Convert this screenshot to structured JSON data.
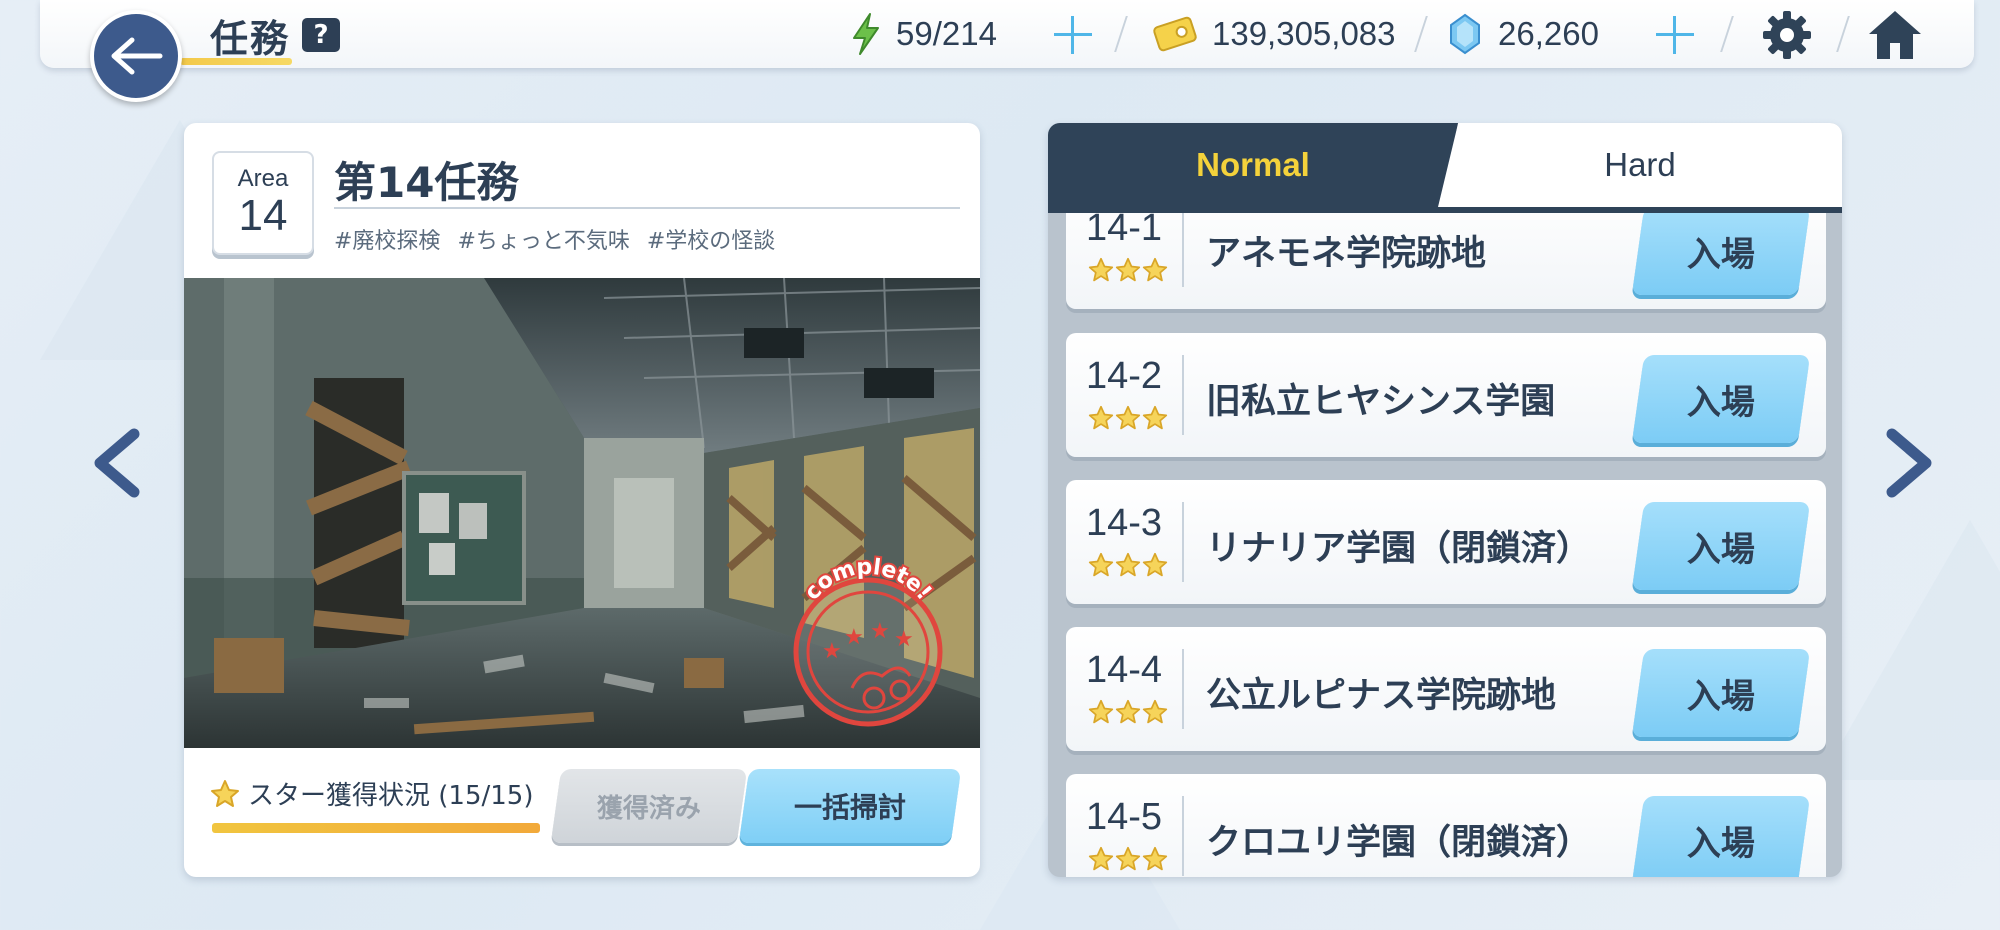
{
  "header": {
    "title": "任務",
    "help_label": "?",
    "stamina": "59/214",
    "credits": "139,305,083",
    "gems": "26,260"
  },
  "mission": {
    "area_label": "Area",
    "area_number": "14",
    "title": "第14任務",
    "tags": [
      "#廃校探検",
      "#ちょっと不気味",
      "#学校の怪談"
    ],
    "stamp_text": "complete!",
    "star_status_label": "スター獲得状況 (15/15)",
    "star_progress": 1.0,
    "claimed_button": "獲得済み",
    "sweep_button": "一括掃討"
  },
  "tabs": {
    "normal": "Normal",
    "hard": "Hard",
    "active": "Normal"
  },
  "quests": [
    {
      "id": "14-1",
      "name": "アネモネ学院跡地",
      "stars": 3,
      "enter_label": "入場"
    },
    {
      "id": "14-2",
      "name": "旧私立ヒヤシンス学園",
      "stars": 3,
      "enter_label": "入場"
    },
    {
      "id": "14-3",
      "name": "リナリア学園（閉鎖済）",
      "stars": 3,
      "enter_label": "入場"
    },
    {
      "id": "14-4",
      "name": "公立ルピナス学院跡地",
      "stars": 3,
      "enter_label": "入場"
    },
    {
      "id": "14-5",
      "name": "クロユリ学園（閉鎖済）",
      "stars": 3,
      "enter_label": "入場"
    }
  ],
  "colors": {
    "navy": "#2f4358",
    "accent_yellow": "#f4d23b",
    "button_blue": "#7fcff6",
    "plus_blue": "#4fb6e8",
    "stamp_red": "#e0463e"
  }
}
